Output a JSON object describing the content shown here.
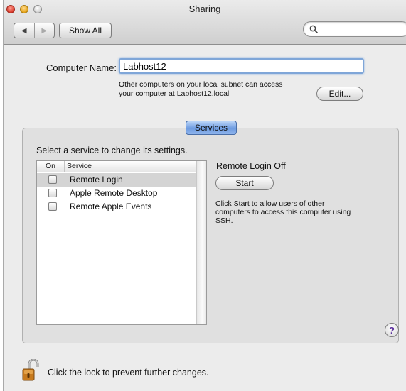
{
  "window": {
    "title": "Sharing"
  },
  "toolbar": {
    "back_glyph": "◀",
    "forward_glyph": "▶",
    "show_all_label": "Show All",
    "search_value": "",
    "search_placeholder": ""
  },
  "computer_name": {
    "label": "Computer Name:",
    "value": "Labhost12",
    "description_line1": "Other computers on your local subnet can access",
    "description_line2": "your computer at Labhost12.local",
    "edit_label": "Edit..."
  },
  "services": {
    "tab_label": "Services",
    "prompt": "Select a service to change its settings.",
    "columns": [
      "On",
      "Service"
    ],
    "items": [
      {
        "label": "Remote Login",
        "checked": false,
        "selected": true
      },
      {
        "label": "Apple Remote Desktop",
        "checked": false,
        "selected": false
      },
      {
        "label": "Remote Apple Events",
        "checked": false,
        "selected": false
      }
    ]
  },
  "detail": {
    "status": "Remote Login Off",
    "start_label": "Start",
    "description_line1": "Click Start to allow users of other",
    "description_line2": "computers to access this computer using",
    "description_line3": "SSH."
  },
  "help": {
    "glyph": "?"
  },
  "footer": {
    "lock_text": "Click the lock to prevent further changes."
  },
  "colors": {
    "accent_tab": "#6d9be0",
    "focus_ring": "#7fa6d8",
    "selection": "#d4d4d4"
  },
  "icons": {
    "search": "magnifier-icon",
    "lock": "open-lock-icon",
    "help": "help-icon"
  }
}
